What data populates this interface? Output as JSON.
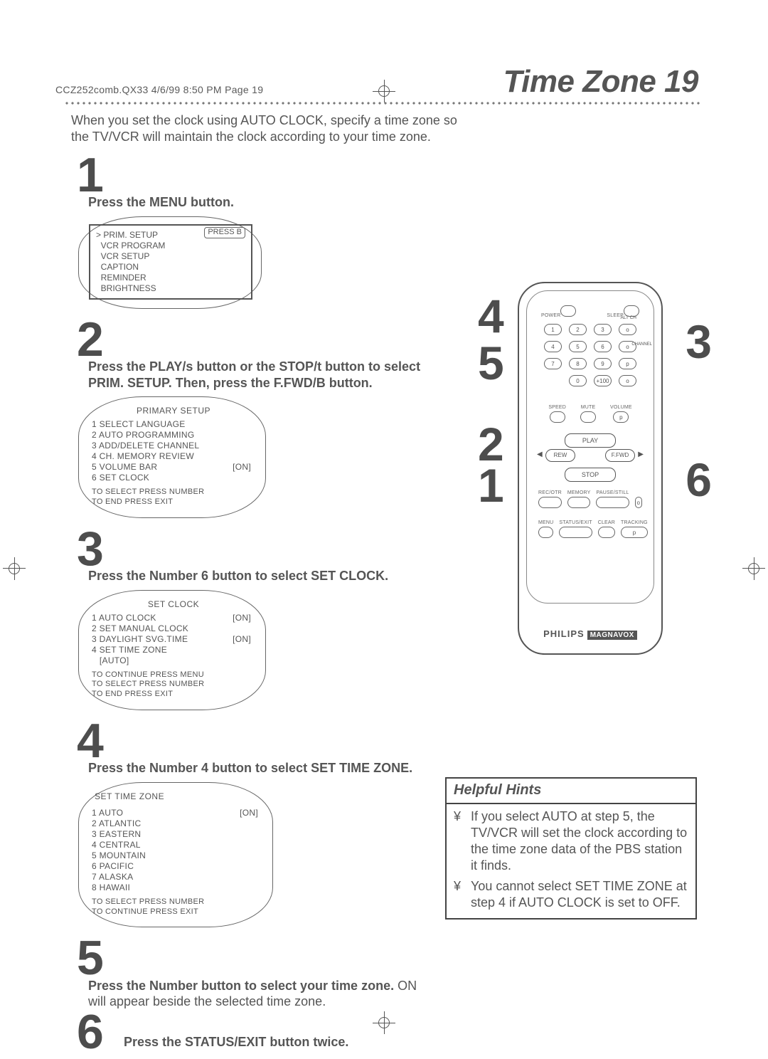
{
  "running_head": "CCZ252comb.QX33  4/6/99 8:50 PM  Page 19",
  "title": "Time Zone  19",
  "intro": "When you set the clock using AUTO CLOCK, specify a time zone so the TV/VCR will maintain the clock according to your time zone.",
  "steps": {
    "s1": {
      "n": "1",
      "text": "Press the MENU button."
    },
    "s2": {
      "n": "2",
      "text_a": "Press the PLAY/s  button or the STOP/t  button to select",
      "text_b": "PRIM. SETUP.  Then, press the F.FWD/B  button."
    },
    "s3": {
      "n": "3",
      "text": "Press the Number 6 button to select SET CLOCK."
    },
    "s4": {
      "n": "4",
      "text": "Press the Number 4 button to select SET TIME ZONE."
    },
    "s5": {
      "n": "5",
      "text_a": "Press the Number button to select your time zone. ",
      "text_b": "ON",
      "text_c": "will appear beside the selected time zone."
    },
    "s6": {
      "n": "6",
      "text": "Press the STATUS/EXIT button twice."
    }
  },
  "screen1": {
    "pressb": "PRESS B",
    "rows": [
      "PRIM. SETUP",
      "VCR PROGRAM",
      "VCR SETUP",
      "CAPTION",
      "REMINDER",
      "BRIGHTNESS"
    ],
    "cursor": ">"
  },
  "screen2": {
    "title": "PRIMARY SETUP",
    "rows": [
      {
        "t": "1 SELECT LANGUAGE"
      },
      {
        "t": "2 AUTO PROGRAMMING"
      },
      {
        "t": "3 ADD/DELETE CHANNEL"
      },
      {
        "t": "4 CH. MEMORY REVIEW"
      },
      {
        "t": "5 VOLUME BAR",
        "v": "[ON]"
      },
      {
        "t": "6 SET CLOCK"
      }
    ],
    "footer": [
      "TO SELECT PRESS NUMBER",
      "TO END PRESS EXIT"
    ]
  },
  "screen3": {
    "title": "SET CLOCK",
    "rows": [
      {
        "t": "1 AUTO CLOCK",
        "v": "[ON]"
      },
      {
        "t": "2 SET MANUAL CLOCK"
      },
      {
        "t": "3 DAYLIGHT SVG.TIME",
        "v": "[ON]"
      },
      {
        "t": "4 SET TIME ZONE"
      },
      {
        "t": "   [AUTO]"
      }
    ],
    "footer": [
      "TO CONTINUE PRESS MENU",
      "TO SELECT PRESS NUMBER",
      "TO END PRESS EXIT"
    ]
  },
  "screen4": {
    "title": "SET TIME ZONE",
    "rows": [
      {
        "t": "1 AUTO",
        "v": "[ON]"
      },
      {
        "t": "2 ATLANTIC"
      },
      {
        "t": "3 EASTERN"
      },
      {
        "t": "4 CENTRAL"
      },
      {
        "t": "5 MOUNTAIN"
      },
      {
        "t": "6 PACIFIC"
      },
      {
        "t": "7 ALASKA"
      },
      {
        "t": "8 HAWAII"
      }
    ],
    "footer": [
      "TO SELECT PRESS NUMBER",
      "TO CONTINUE PRESS EXIT"
    ]
  },
  "remote": {
    "top": {
      "power": "POWER",
      "sleep": "SLEEP",
      "altch": "ALT CH"
    },
    "numpad": [
      "1",
      "2",
      "3",
      "o",
      "4",
      "5",
      "6",
      "o",
      "7",
      "8",
      "9",
      "p",
      "0",
      "+100",
      "o"
    ],
    "numpad_side": {
      "channel": "CHANNEL"
    },
    "speed": {
      "speed": "SPEED",
      "mute": "MUTE",
      "volume": "VOLUME"
    },
    "transport": {
      "play": "PLAY",
      "rew": "REW",
      "ffwd": "F.FWD",
      "stop": "STOP"
    },
    "row4": [
      "REC/OTR",
      "MEMORY",
      "PAUSE/STILL",
      "o"
    ],
    "row5": [
      "MENU",
      "STATUS/EXIT",
      "CLEAR",
      "p"
    ],
    "row4b_lbl": "TRACKING",
    "brand": "PHILIPS",
    "brand2": "MAGNAVOX",
    "callouts": {
      "c4": "4",
      "c5": "5",
      "c2": "2",
      "c1": "1",
      "c3": "3",
      "c6": "6"
    }
  },
  "hints": {
    "head": "Helpful Hints",
    "items": [
      "If you select AUTO at step 5, the TV/VCR will set the clock according to the time zone data of the PBS station it finds.",
      "You cannot select SET TIME ZONE at step 4 if AUTO CLOCK is set to OFF."
    ]
  }
}
